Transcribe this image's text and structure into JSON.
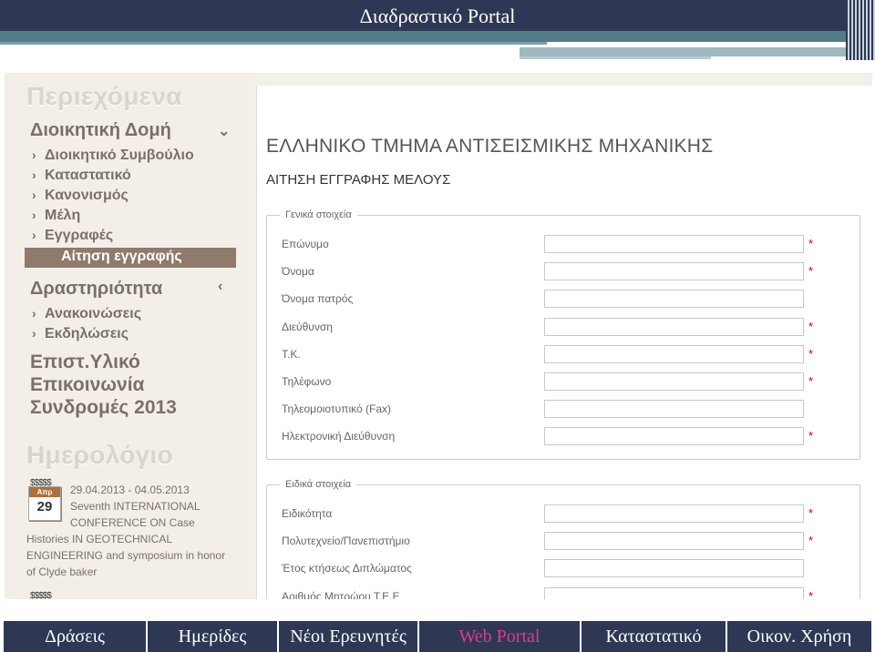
{
  "banner": {
    "title": "Διαδραστικό Portal"
  },
  "sidebar": {
    "heading_contents": "Περιεχόμενα",
    "section_admin": {
      "label": "Διοικητική Δομή",
      "chevron": "chevron-down-icon"
    },
    "admin_items": [
      {
        "label": "Διοικητικό Συμβούλιο"
      },
      {
        "label": "Καταστατικό"
      },
      {
        "label": "Κανονισμός"
      },
      {
        "label": "Μέλη"
      },
      {
        "label": "Εγγραφές"
      }
    ],
    "active_item": "Αίτηση εγγραφής",
    "section_activity": {
      "label": "Δραστηριότητα",
      "chevron": "chevron-left-icon"
    },
    "activity_items": [
      {
        "label": "Ανακοινώσεις"
      },
      {
        "label": "Εκδηλώσεις"
      }
    ],
    "links": [
      {
        "label": "Επιστ.Υλικό"
      },
      {
        "label": "Επικοινωνία"
      },
      {
        "label": "Συνδρομές 2013"
      }
    ],
    "heading_calendar": "Ημερολόγιο",
    "calendar": {
      "dollars_top": "$$$$$",
      "icon_month": "Απρ",
      "icon_day": "29",
      "lines": [
        "29.04.2013 - 04.05.2013",
        "Seventh INTERNATIONAL",
        "CONFERENCE ON Case",
        "Histories IN GEOTECHNICAL",
        "ENGINEERING and symposium in honor",
        "of Clyde baker"
      ],
      "dollars_bottom": "$$$$$"
    }
  },
  "main": {
    "org_title": "ΕΛΛΗΝΙΚΟ ΤΜΗΜΑ ΑΝΤΙΣΕΙΣΜΙΚΗΣ ΜΗΧΑΝΙΚΗΣ",
    "form_title": "ΑΙΤΗΣΗ ΕΓΓΡΑΦΗΣ ΜΕΛΟΥΣ",
    "required_mark": "*",
    "general": {
      "legend": "Γενικά στοιχεία",
      "fields": [
        {
          "label": "Επώνυμο",
          "value": "",
          "required": true
        },
        {
          "label": "Όνομα",
          "value": "",
          "required": true
        },
        {
          "label": "Όνομα πατρός",
          "value": "",
          "required": false
        },
        {
          "label": "Διεύθυνση",
          "value": "",
          "required": true
        },
        {
          "label": "Τ.Κ.",
          "value": "",
          "required": true
        },
        {
          "label": "Τηλέφωνο",
          "value": "",
          "required": true
        },
        {
          "label": "Τηλεομοιοτυπικό (Fax)",
          "value": "",
          "required": false
        },
        {
          "label": "Ηλεκτρονική Διεύθυνση",
          "value": "",
          "required": true
        }
      ]
    },
    "special": {
      "legend": "Ειδικά στοιχεία",
      "fields": [
        {
          "label": "Ειδικότητα",
          "value": "",
          "required": true
        },
        {
          "label": "Πολυτεχνείο/Πανεπιστήμιο",
          "value": "",
          "required": true
        },
        {
          "label": "Έτος κτήσεως Διπλώματος",
          "value": "",
          "required": false
        },
        {
          "label": "Αριθμός Μητρώου Τ.Ε.Ε",
          "value": "",
          "required": true
        }
      ]
    }
  },
  "bottom_nav": {
    "items": [
      {
        "label": "Δράσεις"
      },
      {
        "label": "Ημερίδες"
      },
      {
        "label": "Νέοι Ερευνητές"
      },
      {
        "label": "Web Portal"
      },
      {
        "label": "Καταστατικό"
      },
      {
        "label": "Οικον. Χρήση"
      }
    ],
    "active_color": "#e0398e"
  }
}
